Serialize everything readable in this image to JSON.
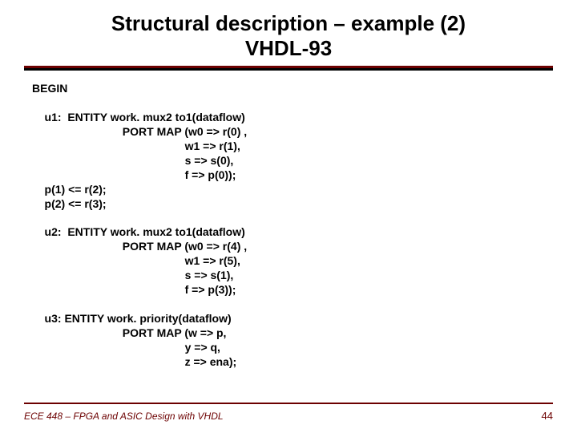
{
  "title": {
    "line1": "Structural description – example (2)",
    "line2": "VHDL-93"
  },
  "code": {
    "begin": "BEGIN",
    "u1_line1": "    u1:  ENTITY work. mux2 to1(dataflow)",
    "u1_line2": "                             PORT MAP (w0 => r(0) ,",
    "u1_line3": "                                                 w1 => r(1),",
    "u1_line4": "                                                 s => s(0),",
    "u1_line5": "                                                 f => p(0));",
    "assign1": "    p(1) <= r(2);",
    "assign2": "    p(2) <= r(3);",
    "u2_line1": "    u2:  ENTITY work. mux2 to1(dataflow)",
    "u2_line2": "                             PORT MAP (w0 => r(4) ,",
    "u2_line3": "                                                 w1 => r(5),",
    "u2_line4": "                                                 s => s(1),",
    "u2_line5": "                                                 f => p(3));",
    "u3_line1": "    u3: ENTITY work. priority(dataflow)",
    "u3_line2": "                             PORT MAP (w => p,",
    "u3_line3": "                                                 y => q,",
    "u3_line4": "                                                 z => ena);"
  },
  "footer": "ECE 448 – FPGA and ASIC Design with VHDL",
  "page_number": "44"
}
